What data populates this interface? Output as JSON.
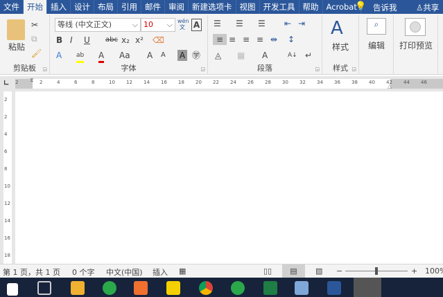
{
  "tabs": [
    "文件",
    "开始",
    "插入",
    "设计",
    "布局",
    "引用",
    "邮件",
    "审阅",
    "新建选项卡",
    "视图",
    "开发工具",
    "帮助",
    "Acrobat"
  ],
  "active_tab": "开始",
  "tell_me": "告诉我",
  "share": "共享",
  "clipboard": {
    "paste": "粘贴",
    "label": "剪贴板"
  },
  "font": {
    "name": "等线 (中文正文)",
    "size": "10",
    "label": "字体",
    "phonetic": "wén 文",
    "bold": "B",
    "italic": "I",
    "underline": "U",
    "strike": "abc",
    "sub": "x₂",
    "sup": "x²",
    "font_color": "A",
    "case": "Aa",
    "grow": "A",
    "shrink": "A"
  },
  "paragraph": {
    "label": "段落"
  },
  "styles": {
    "button": "样式",
    "label": "样式"
  },
  "editing": {
    "button": "编辑"
  },
  "print_preview": {
    "button": "打印预览"
  },
  "ruler": {
    "h_numbers": [
      "2",
      "2",
      "4",
      "6",
      "8",
      "10",
      "12",
      "14",
      "16",
      "18",
      "20",
      "22",
      "24",
      "26",
      "28",
      "30",
      "32",
      "34",
      "36",
      "38",
      "40",
      "42",
      "44",
      "46"
    ],
    "v_numbers": [
      "2",
      "2",
      "4",
      "6",
      "8",
      "10",
      "12",
      "14",
      "16",
      "18"
    ]
  },
  "status": {
    "page": "第 1 页，共 1 页",
    "words": "0 个字",
    "language": "中文(中国)",
    "mode": "插入",
    "zoom": "100%",
    "zoom_fraction": 0.5
  },
  "colors": {
    "accent": "#2b579a",
    "highlight": "#ffff00",
    "font_color": "#e00000"
  }
}
